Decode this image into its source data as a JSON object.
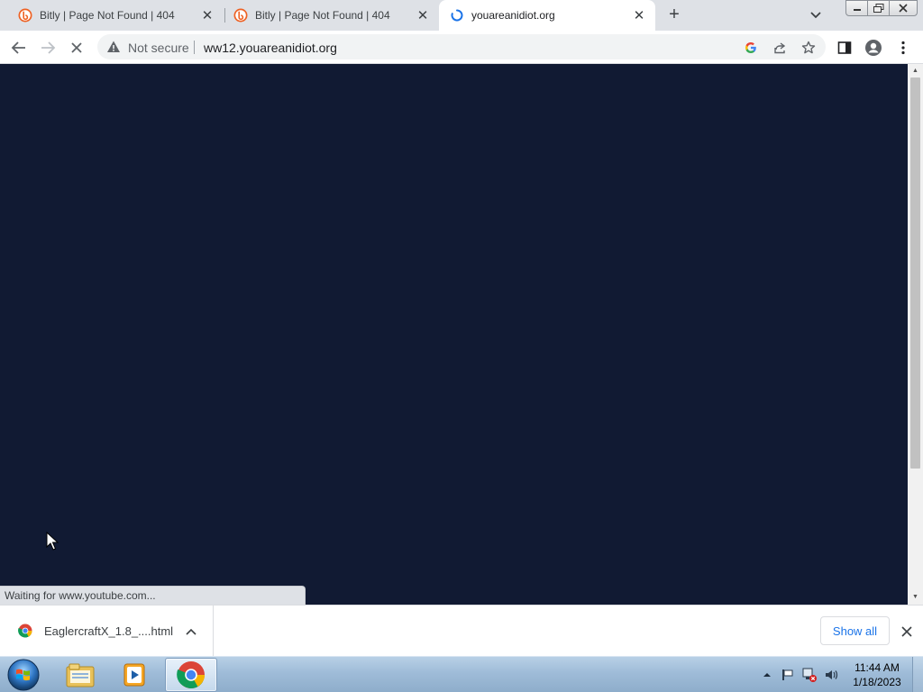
{
  "browser": {
    "tabs": [
      {
        "title": "Bitly | Page Not Found | 404",
        "icon": "bitly-icon"
      },
      {
        "title": "Bitly | Page Not Found | 404",
        "icon": "bitly-icon"
      },
      {
        "title": "youareanidiot.org",
        "icon": "loading-spinner-icon",
        "active": true
      }
    ],
    "omnibox": {
      "security_label": "Not secure",
      "url": "ww12.youareanidiot.org"
    },
    "status_bubble": "Waiting for www.youtube.com...",
    "page_background": "#111a33"
  },
  "downloads": {
    "items": [
      {
        "filename": "EaglercraftX_1.8_....html"
      }
    ],
    "show_all_label": "Show all"
  },
  "taskbar": {
    "apps": [
      "windows-explorer",
      "media-player",
      "google-chrome"
    ],
    "clock": {
      "time": "11:44 AM",
      "date": "1/18/2023"
    }
  },
  "colors": {
    "accent": "#1a73e8",
    "tab_strip": "#dee1e6",
    "bitly_orange": "#ee6123"
  }
}
